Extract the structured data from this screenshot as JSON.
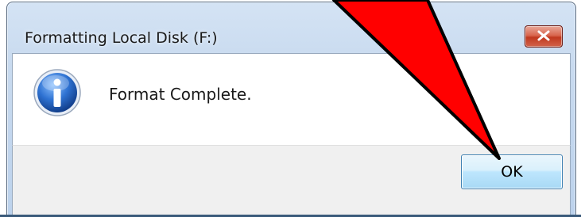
{
  "dialog": {
    "title": "Formatting Local Disk (F:)",
    "message": "Format Complete.",
    "ok_label": "OK",
    "icon": "info-icon"
  },
  "annotation": {
    "arrow_color": "#ff0000",
    "target": "ok-button"
  },
  "colors": {
    "close_button": "#c0391f",
    "ok_button_border": "#3c7fb1",
    "info_icon": "#1f5fb8"
  }
}
